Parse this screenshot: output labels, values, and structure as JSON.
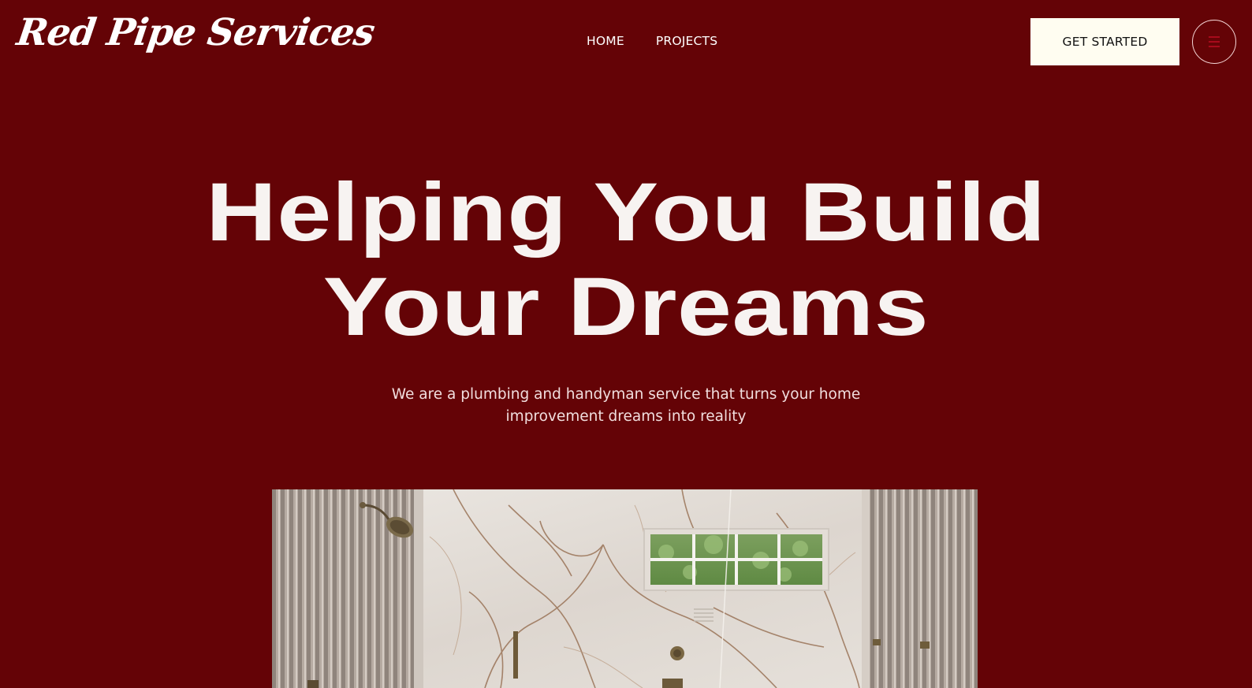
{
  "brand": {
    "logo_text": "Red Pipe Services"
  },
  "nav": {
    "items": [
      {
        "label": "HOME"
      },
      {
        "label": "PROJECTS"
      }
    ]
  },
  "header": {
    "cta_label": "GET STARTED",
    "menu_icon": "hamburger-icon"
  },
  "hero": {
    "title_line1": "Helping You Build",
    "title_line2": "Your Dreams",
    "subtitle_line1": "We are a plumbing and handyman service that turns your home",
    "subtitle_line2": "improvement dreams into reality",
    "image_subject": "bathroom-shower-photo"
  },
  "colors": {
    "background": "#640306",
    "cta_background": "#fffdf1",
    "text_light": "#ffffff",
    "accent_red": "#c8102e"
  }
}
